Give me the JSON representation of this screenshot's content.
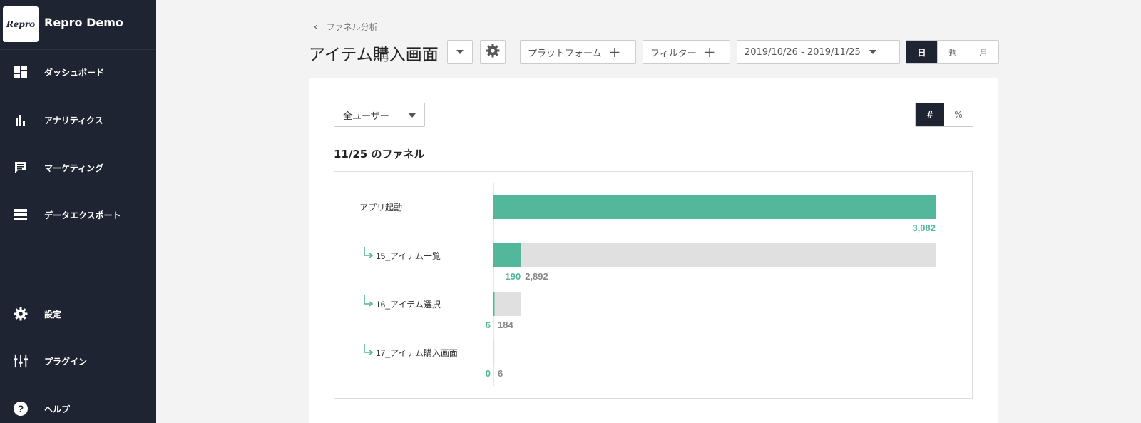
{
  "app": {
    "logo_text": "Repro",
    "name": "Repro Demo"
  },
  "sidebar": {
    "top_items": [
      {
        "label": "ダッシュボード",
        "icon": "dashboard-icon"
      },
      {
        "label": "アナリティクス",
        "icon": "bar-chart-icon"
      },
      {
        "label": "マーケティング",
        "icon": "message-icon"
      },
      {
        "label": "データエクスポート",
        "icon": "storage-icon"
      }
    ],
    "bottom_items": [
      {
        "label": "設定",
        "icon": "gear-icon"
      },
      {
        "label": "プラグイン",
        "icon": "plugin-icon"
      },
      {
        "label": "ヘルプ",
        "icon": "help-icon"
      }
    ]
  },
  "header": {
    "breadcrumb": "ファネル分析",
    "title": "アイテム購入画面",
    "platform_label": "プラットフォーム",
    "filter_label": "フィルター",
    "date_range": "2019/10/26 - 2019/11/25",
    "period_options": [
      "日",
      "週",
      "月"
    ],
    "period_selected": "日"
  },
  "card": {
    "user_segment": "全ユーザー",
    "display_options": [
      "#",
      "%"
    ],
    "display_selected": "#",
    "funnel_title": "11/25 のファネル"
  },
  "colors": {
    "accent": "#52b79b",
    "dropoff": "#e0e0e0",
    "sidebar": "#1f2432"
  },
  "chart_data": {
    "type": "bar",
    "orientation": "horizontal-funnel",
    "steps": [
      {
        "label": "アプリ起動",
        "converted": 3082,
        "dropped": null,
        "converted_label": "3,082",
        "dropped_label": ""
      },
      {
        "label": "15_アイテム一覧",
        "converted": 190,
        "dropped": 2892,
        "converted_label": "190",
        "dropped_label": "2,892"
      },
      {
        "label": "16_アイテム選択",
        "converted": 6,
        "dropped": 184,
        "converted_label": "6",
        "dropped_label": "184"
      },
      {
        "label": "17_アイテム購入画面",
        "converted": 0,
        "dropped": 6,
        "converted_label": "0",
        "dropped_label": "6"
      }
    ],
    "max": 3082
  }
}
